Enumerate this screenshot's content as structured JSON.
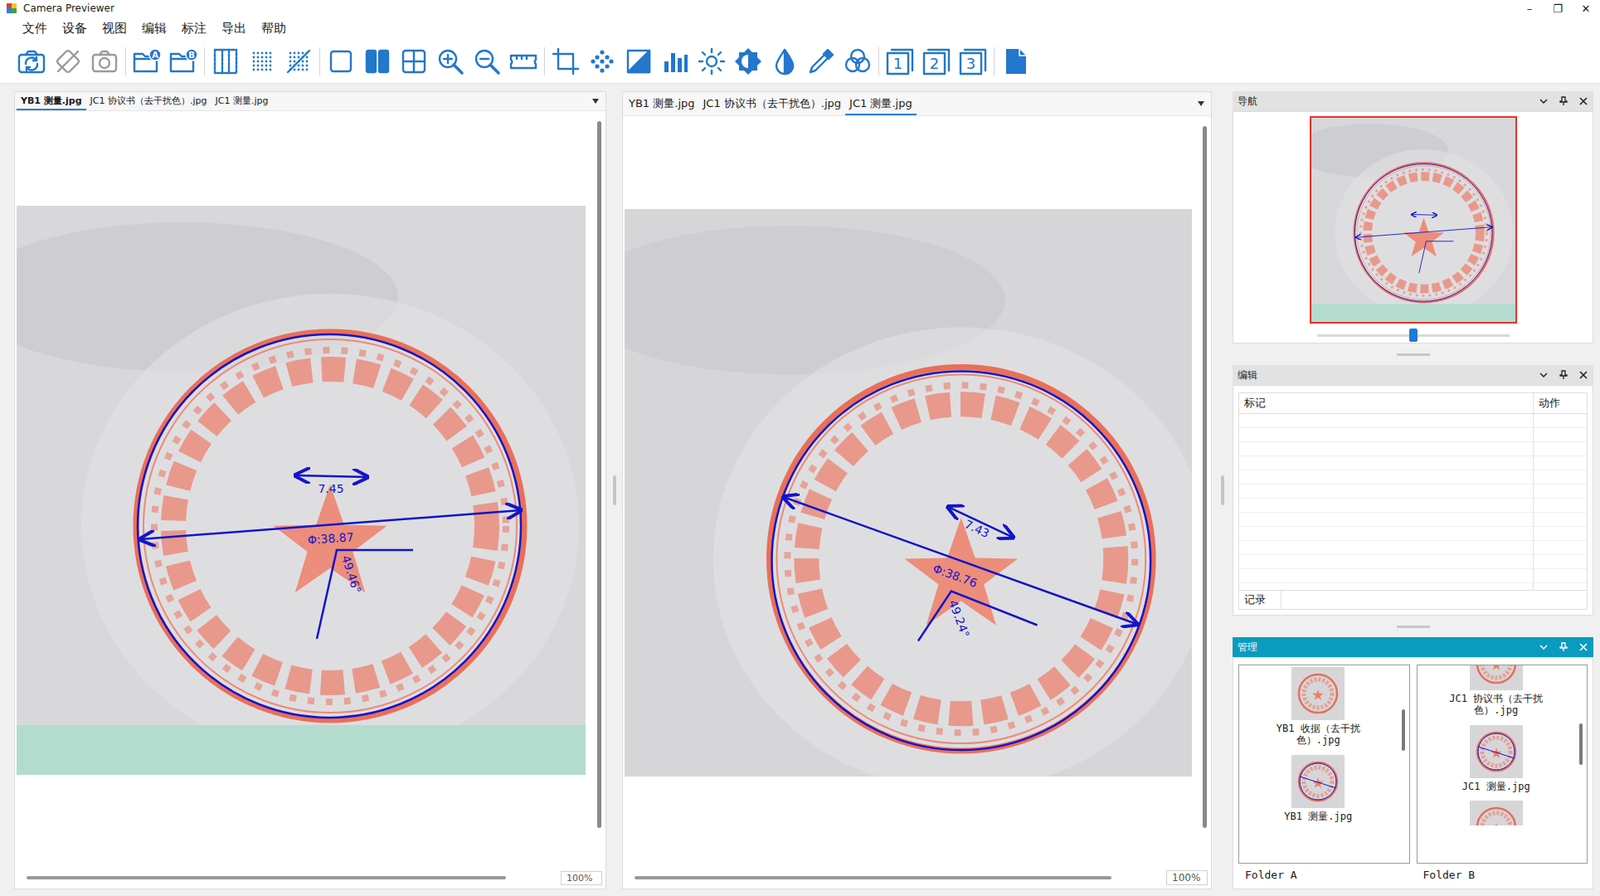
{
  "window": {
    "title": "Camera Previewer",
    "controls": [
      "–",
      "❐",
      "✕"
    ]
  },
  "menu": [
    "文件",
    "设备",
    "视图",
    "编辑",
    "标注",
    "导出",
    "帮助"
  ],
  "toolbar": [
    [
      {
        "icon": "camera-refresh",
        "disabled": false
      },
      {
        "icon": "rotate",
        "disabled": true
      },
      {
        "icon": "snapshot",
        "disabled": true
      }
    ],
    [
      {
        "icon": "folder",
        "badge": "A",
        "disabled": false
      },
      {
        "icon": "folder",
        "badge": "B",
        "disabled": false
      }
    ],
    [
      {
        "icon": "grid-lines",
        "disabled": false
      },
      {
        "icon": "dot-grid",
        "disabled": false
      },
      {
        "icon": "dot-grid-off",
        "disabled": false
      }
    ],
    [
      {
        "icon": "single-view",
        "disabled": false
      },
      {
        "icon": "dual-view",
        "disabled": false
      },
      {
        "icon": "quad-view",
        "disabled": false
      },
      {
        "icon": "zoom-in",
        "disabled": false
      },
      {
        "icon": "zoom-out",
        "disabled": false
      },
      {
        "icon": "ruler",
        "disabled": false
      }
    ],
    [
      {
        "icon": "crop",
        "disabled": false
      },
      {
        "icon": "scatter",
        "disabled": false
      },
      {
        "icon": "contrast",
        "disabled": false
      },
      {
        "icon": "histogram",
        "disabled": false
      },
      {
        "icon": "sun",
        "disabled": false
      },
      {
        "icon": "brightness",
        "disabled": false
      },
      {
        "icon": "invert",
        "disabled": false
      },
      {
        "icon": "eyedropper",
        "disabled": false
      },
      {
        "icon": "channels",
        "disabled": false
      }
    ],
    [
      {
        "icon": "number",
        "badge": "1",
        "disabled": false
      },
      {
        "icon": "number",
        "badge": "2",
        "disabled": false
      },
      {
        "icon": "number",
        "badge": "3",
        "disabled": false
      }
    ],
    [
      {
        "icon": "document",
        "disabled": false
      }
    ]
  ],
  "panes": [
    {
      "tabs": [
        {
          "label": "YB1 测量.jpg",
          "selected": true
        },
        {
          "label": "JC1 协议书（去干扰色）.jpg",
          "selected": false
        },
        {
          "label": "JC1 测量.jpg",
          "selected": false
        }
      ],
      "zoom": "100%",
      "measurements": {
        "width": "7.45",
        "diameter": "Φ:38.87",
        "angle": "49.46°"
      }
    },
    {
      "tabs": [
        {
          "label": "YB1 测量.jpg",
          "selected": false
        },
        {
          "label": "JC1 协议书（去干扰色）.jpg",
          "selected": false
        },
        {
          "label": "JC1 测量.jpg",
          "selected": true
        }
      ],
      "zoom": "100%",
      "measurements": {
        "width": "7.43",
        "diameter": "Φ:38.76",
        "angle": "49.24°"
      }
    }
  ],
  "navigator": {
    "title": "导航",
    "active": false,
    "level": 0.5
  },
  "editor": {
    "title": "编辑",
    "active": false,
    "columns": [
      "标记",
      "动作"
    ],
    "rows": [],
    "record_label": "记录",
    "record_value": ""
  },
  "manager": {
    "title": "管理",
    "active": true,
    "folders": [
      {
        "name": "Folder A",
        "scroll": 0.28,
        "items": [
          {
            "name": "YB1 收据（去干扰色）.jpg",
            "annotated": false,
            "clip": "none"
          },
          {
            "name": "YB1 测量.jpg",
            "annotated": true,
            "clip": "none"
          }
        ]
      },
      {
        "name": "Folder B",
        "scroll": 0.37,
        "items": [
          {
            "name": "JC1 协议书（去干扰色）.jpg",
            "annotated": false,
            "clip": "top"
          },
          {
            "name": "JC1 测量.jpg",
            "annotated": true,
            "clip": "none"
          },
          {
            "name": "",
            "annotated": false,
            "clip": "bottom"
          }
        ]
      }
    ]
  }
}
